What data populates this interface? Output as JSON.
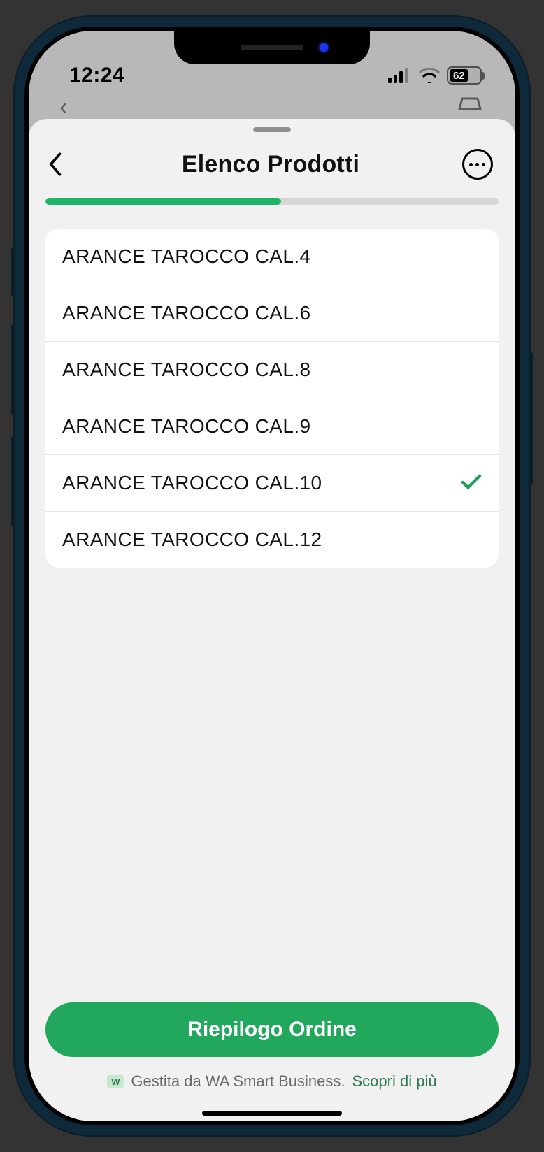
{
  "status": {
    "time": "12:24",
    "battery_percent": "62"
  },
  "sheet": {
    "title": "Elenco Prodotti",
    "progress_percent": 52
  },
  "products": [
    {
      "label": "ARANCE TAROCCO CAL.4",
      "selected": false
    },
    {
      "label": "ARANCE TAROCCO CAL.6",
      "selected": false
    },
    {
      "label": "ARANCE TAROCCO CAL.8",
      "selected": false
    },
    {
      "label": "ARANCE TAROCCO CAL.9",
      "selected": false
    },
    {
      "label": "ARANCE TAROCCO CAL.10",
      "selected": true
    },
    {
      "label": "ARANCE TAROCCO CAL.12",
      "selected": false
    }
  ],
  "footer": {
    "primary_button": "Riepilogo Ordine",
    "managed_prefix": "Gestita da WA Smart Business.",
    "managed_link": "Scopri di più",
    "badge": "W"
  }
}
